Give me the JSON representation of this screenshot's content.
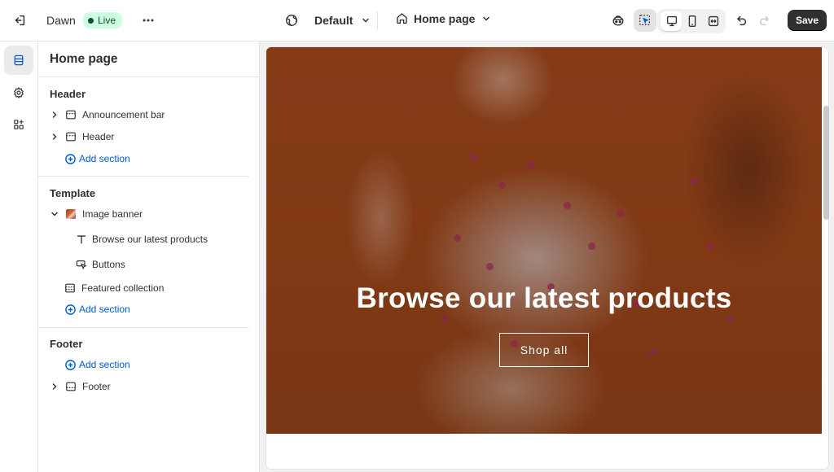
{
  "topbar": {
    "exit_icon": "exit-icon",
    "store_name": "Dawn",
    "live_badge": "Live",
    "more_icon": "more-horizontal-icon",
    "theme_selector": "Default",
    "page_selector": "Home page",
    "save_label": "Save"
  },
  "rail": {
    "items": [
      {
        "icon": "sections-icon",
        "active": true
      },
      {
        "icon": "settings-gear-icon",
        "active": false
      },
      {
        "icon": "apps-icon",
        "active": false
      }
    ]
  },
  "panel": {
    "title": "Home page",
    "groups": {
      "header": {
        "title": "Header",
        "items": [
          "Announcement bar",
          "Header"
        ],
        "add_label": "Add section"
      },
      "template": {
        "title": "Template",
        "image_banner": "Image banner",
        "blocks": [
          "Browse our latest products",
          "Buttons"
        ],
        "featured": "Featured collection",
        "add_label": "Add section"
      },
      "footer": {
        "title": "Footer",
        "add_label": "Add section",
        "items": [
          "Footer"
        ]
      }
    }
  },
  "preview": {
    "heading": "Browse our latest products",
    "button": "Shop all"
  },
  "colors": {
    "accent": "#005bd3",
    "live_bg": "#cdfee1",
    "live_text": "#0c5132",
    "save_bg": "#303030"
  }
}
